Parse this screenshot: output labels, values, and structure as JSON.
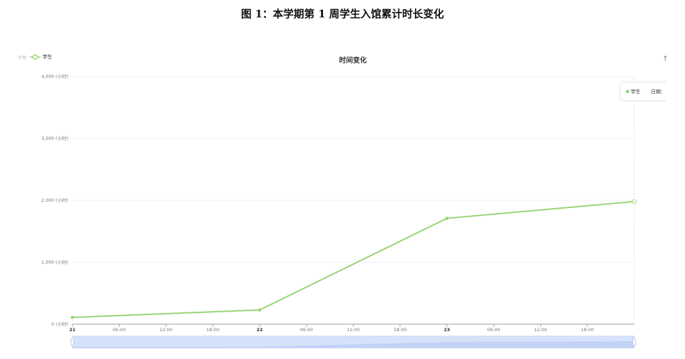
{
  "figure_caption": "图 1：本学期第 1 周学生入馆累计时长变化",
  "legend": {
    "prefix": "护理",
    "series_label": "学生"
  },
  "chart_title": "时间变化",
  "corner_icon": "↑",
  "tooltip": {
    "series": "学生",
    "date_label": "日期："
  },
  "colors": {
    "series": "#97d574",
    "grid": "#ececec",
    "axis": "#999999",
    "slider": "#d6e2fa"
  },
  "chart_data": {
    "type": "line",
    "title": "时间变化",
    "xlabel": "",
    "ylabel": "",
    "y_unit_suffix": " (小时)",
    "ylim": [
      0,
      4000
    ],
    "y_ticks": [
      0,
      1000,
      2000,
      3000,
      4000
    ],
    "y_tick_labels": [
      "0 (小时)",
      "1,000 (小时)",
      "2,000 (小时)",
      "3,000 (小时)",
      "4,000 (小时)"
    ],
    "x_range_hours": [
      0,
      72
    ],
    "x_ticks": [
      {
        "hour": 0,
        "label": "21",
        "bold": true
      },
      {
        "hour": 6,
        "label": "06:00",
        "bold": false
      },
      {
        "hour": 12,
        "label": "12:00",
        "bold": false
      },
      {
        "hour": 18,
        "label": "18:00",
        "bold": false
      },
      {
        "hour": 24,
        "label": "22",
        "bold": true
      },
      {
        "hour": 30,
        "label": "06:00",
        "bold": false
      },
      {
        "hour": 36,
        "label": "12:00",
        "bold": false
      },
      {
        "hour": 42,
        "label": "18:00",
        "bold": false
      },
      {
        "hour": 48,
        "label": "23",
        "bold": true
      },
      {
        "hour": 54,
        "label": "06:00",
        "bold": false
      },
      {
        "hour": 60,
        "label": "12:00",
        "bold": false
      },
      {
        "hour": 66,
        "label": "18:00",
        "bold": false
      }
    ],
    "grid": true,
    "legend_position": "top-left",
    "series": [
      {
        "name": "学生",
        "x": [
          0,
          24,
          48,
          72
        ],
        "values": [
          110,
          230,
          1710,
          1980
        ]
      }
    ]
  }
}
